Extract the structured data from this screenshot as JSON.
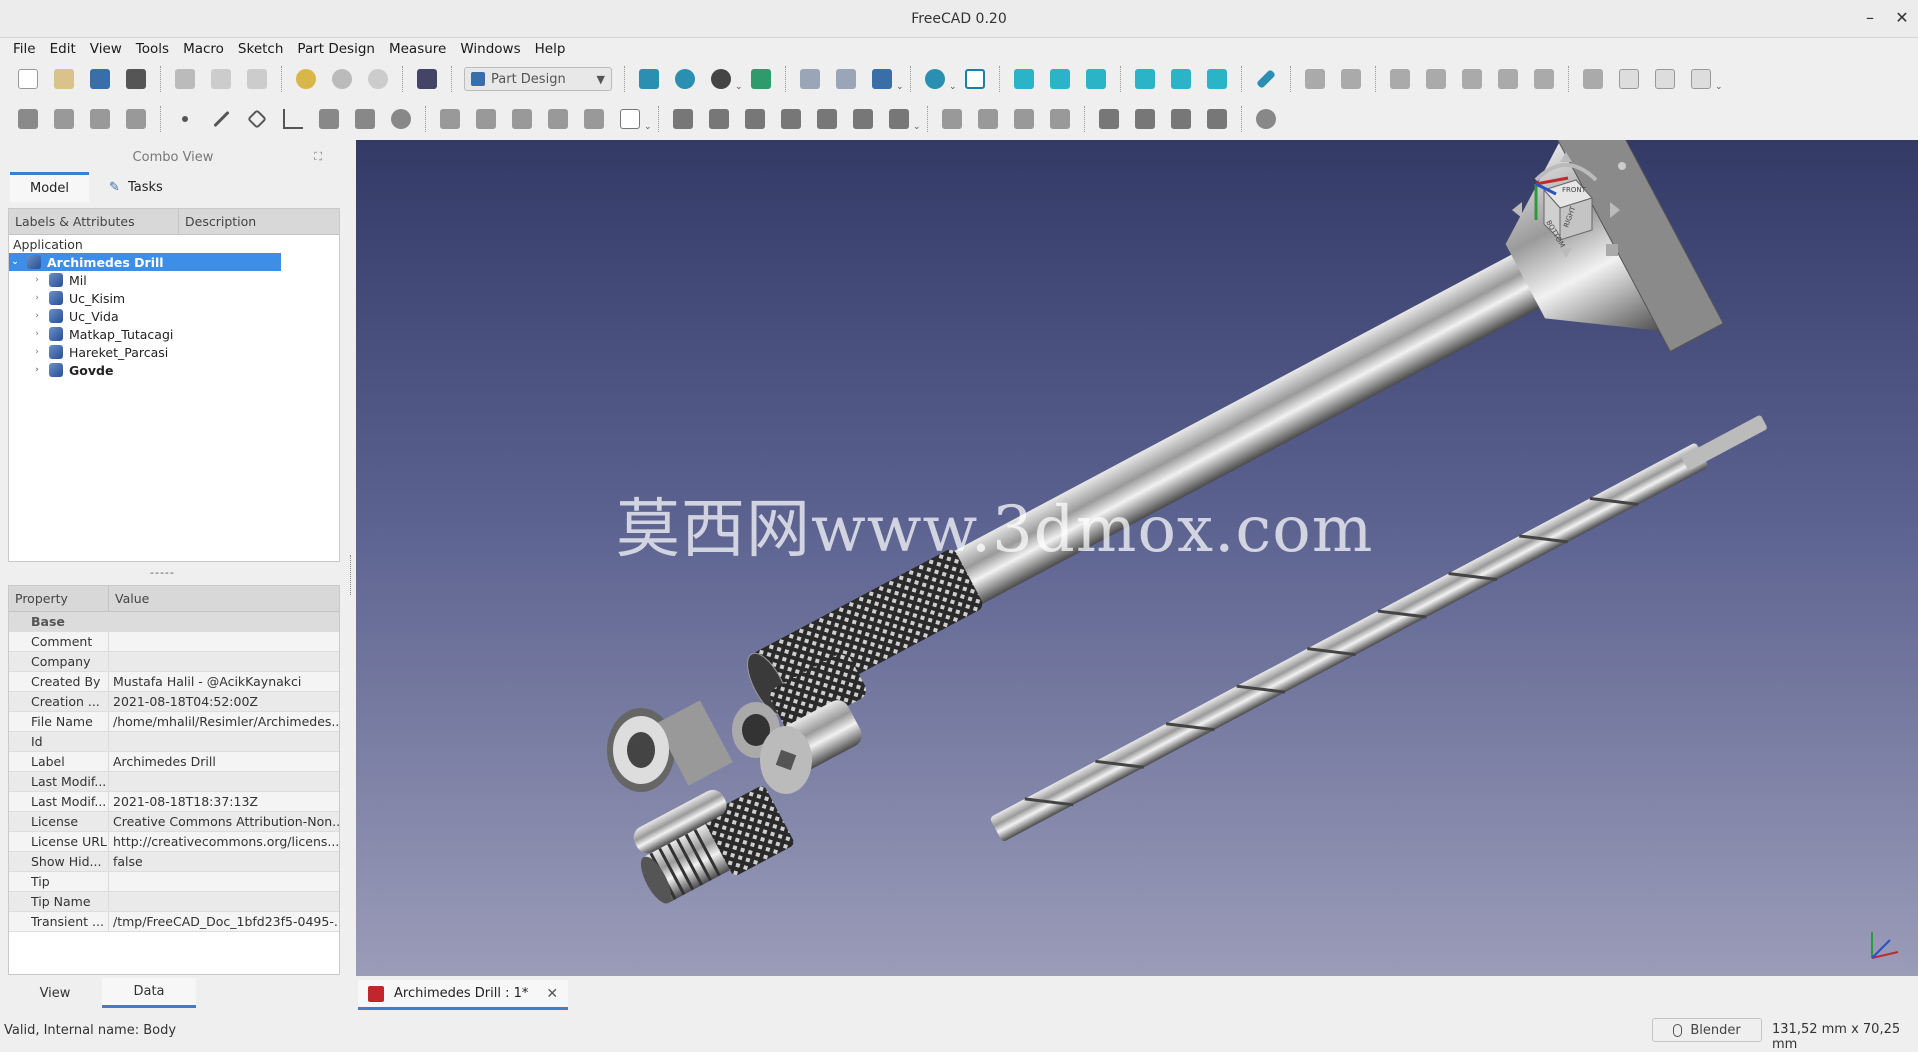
{
  "window": {
    "title": "FreeCAD 0.20",
    "minimize": "–",
    "close": "✕"
  },
  "menu": [
    "File",
    "Edit",
    "View",
    "Tools",
    "Macro",
    "Sketch",
    "Part Design",
    "Measure",
    "Windows",
    "Help"
  ],
  "workbench": {
    "selected": "Part Design"
  },
  "combo_view": {
    "title": "Combo View",
    "tabs": [
      "Model",
      "Tasks"
    ],
    "tree_headers": [
      "Labels & Attributes",
      "Description"
    ],
    "section": "Application",
    "root": "Archimedes Drill",
    "children": [
      "Mil",
      "Uc_Kisim",
      "Uc_Vida",
      "Matkap_Tutacagi",
      "Hareket_Parcasi",
      "Govde"
    ],
    "splitter": "-----",
    "property_headers": [
      "Property",
      "Value"
    ],
    "group": "Base",
    "properties": [
      {
        "name": "Comment",
        "value": ""
      },
      {
        "name": "Company",
        "value": ""
      },
      {
        "name": "Created By",
        "value": "Mustafa Halil - @AcikKaynakci"
      },
      {
        "name": "Creation ...",
        "value": "2021-08-18T04:52:00Z"
      },
      {
        "name": "File Name",
        "value": "/home/mhalil/Resimler/Archimedes..."
      },
      {
        "name": "Id",
        "value": ""
      },
      {
        "name": "Label",
        "value": "Archimedes Drill"
      },
      {
        "name": "Last Modif...",
        "value": ""
      },
      {
        "name": "Last Modif...",
        "value": "2021-08-18T18:37:13Z"
      },
      {
        "name": "License",
        "value": "Creative Commons Attribution-Non..."
      },
      {
        "name": "License URL",
        "value": "http://creativecommons.org/licens..."
      },
      {
        "name": "Show Hid...",
        "value": "false"
      },
      {
        "name": "Tip",
        "value": ""
      },
      {
        "name": "Tip Name",
        "value": ""
      },
      {
        "name": "Transient ...",
        "value": "/tmp/FreeCAD_Doc_1bfd23f5-0495-..."
      }
    ],
    "bottom_tabs": [
      "View",
      "Data"
    ]
  },
  "viewport": {
    "watermark": "莫西网www.3dmox.com",
    "cube_faces": [
      "FRONT",
      "BOTTOM",
      "RIGHT"
    ]
  },
  "document_tab": {
    "label": "Archimedes Drill : 1*",
    "close": "✕"
  },
  "status": {
    "message": "Valid, Internal name: Body",
    "nav_style": "Blender",
    "dimensions": "131,52 mm x 70,25 mm"
  },
  "colors": {
    "accent": "#3b7fd4",
    "selection": "#3d8ee8",
    "viewport_top": "#333a66",
    "viewport_bottom": "#9a9cb8"
  }
}
